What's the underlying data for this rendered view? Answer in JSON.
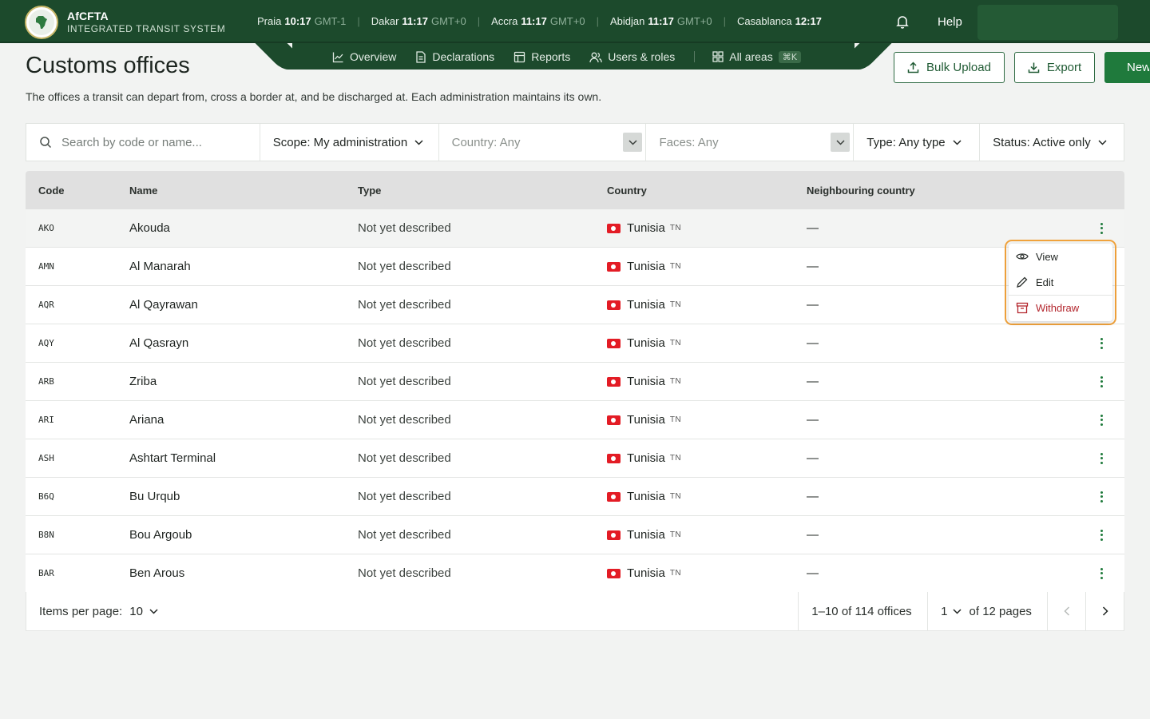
{
  "brand": {
    "name": "AfCFTA",
    "subtitle": "INTEGRATED TRANSIT SYSTEM"
  },
  "clocks": [
    {
      "city": "Praia",
      "time": "10:17",
      "tz": "GMT-1"
    },
    {
      "city": "Dakar",
      "time": "11:17",
      "tz": "GMT+0"
    },
    {
      "city": "Accra",
      "time": "11:17",
      "tz": "GMT+0"
    },
    {
      "city": "Abidjan",
      "time": "11:17",
      "tz": "GMT+0"
    },
    {
      "city": "Casablanca",
      "time": "12:17",
      "tz": ""
    }
  ],
  "header": {
    "help_label": "Help"
  },
  "nav": {
    "tabs": [
      {
        "label": "Overview",
        "icon": "chart-line-icon"
      },
      {
        "label": "Declarations",
        "icon": "document-icon"
      },
      {
        "label": "Reports",
        "icon": "table-icon"
      },
      {
        "label": "Users & roles",
        "icon": "users-icon"
      }
    ],
    "all_areas": {
      "label": "All areas",
      "shortcut": "⌘K"
    }
  },
  "page": {
    "title": "Customs offices",
    "description": "The offices a transit can depart from, cross a border at, and be discharged at. Each administration maintains its own."
  },
  "actions": {
    "bulk_upload": "Bulk Upload",
    "export": "Export",
    "new": "New"
  },
  "filters": {
    "search_placeholder": "Search by code or name...",
    "scope": "Scope: My administration",
    "country": "Country: Any",
    "faces": "Faces: Any",
    "type": "Type: Any type",
    "status": "Status: Active only"
  },
  "table": {
    "columns": {
      "code": "Code",
      "name": "Name",
      "type": "Type",
      "country": "Country",
      "neighbouring": "Neighbouring country"
    },
    "rows": [
      {
        "code": "AKO",
        "name": "Akouda",
        "type": "Not yet described",
        "country": "Tunisia",
        "iso": "TN",
        "neighbouring": "—"
      },
      {
        "code": "AMN",
        "name": "Al Manarah",
        "type": "Not yet described",
        "country": "Tunisia",
        "iso": "TN",
        "neighbouring": "—"
      },
      {
        "code": "AQR",
        "name": "Al Qayrawan",
        "type": "Not yet described",
        "country": "Tunisia",
        "iso": "TN",
        "neighbouring": "—"
      },
      {
        "code": "AQY",
        "name": "Al Qasrayn",
        "type": "Not yet described",
        "country": "Tunisia",
        "iso": "TN",
        "neighbouring": "—"
      },
      {
        "code": "ARB",
        "name": "Zriba",
        "type": "Not yet described",
        "country": "Tunisia",
        "iso": "TN",
        "neighbouring": "—"
      },
      {
        "code": "ARI",
        "name": "Ariana",
        "type": "Not yet described",
        "country": "Tunisia",
        "iso": "TN",
        "neighbouring": "—"
      },
      {
        "code": "ASH",
        "name": "Ashtart Terminal",
        "type": "Not yet described",
        "country": "Tunisia",
        "iso": "TN",
        "neighbouring": "—"
      },
      {
        "code": "B6Q",
        "name": "Bu Urqub",
        "type": "Not yet described",
        "country": "Tunisia",
        "iso": "TN",
        "neighbouring": "—"
      },
      {
        "code": "B8N",
        "name": "Bou Argoub",
        "type": "Not yet described",
        "country": "Tunisia",
        "iso": "TN",
        "neighbouring": "—"
      },
      {
        "code": "BAR",
        "name": "Ben Arous",
        "type": "Not yet described",
        "country": "Tunisia",
        "iso": "TN",
        "neighbouring": "—"
      }
    ]
  },
  "pagination": {
    "items_per_page_label": "Items per page:",
    "items_per_page": "10",
    "range": "1–10 of 114 offices",
    "current_page": "1",
    "total_pages_label": "of 12 pages"
  },
  "row_menu": {
    "view": "View",
    "edit": "Edit",
    "withdraw": "Withdraw"
  },
  "colors": {
    "brand_green": "#1c4a2c",
    "accent_green": "#1f7a3c",
    "danger": "#b3262d",
    "highlight": "#f0a23c"
  }
}
